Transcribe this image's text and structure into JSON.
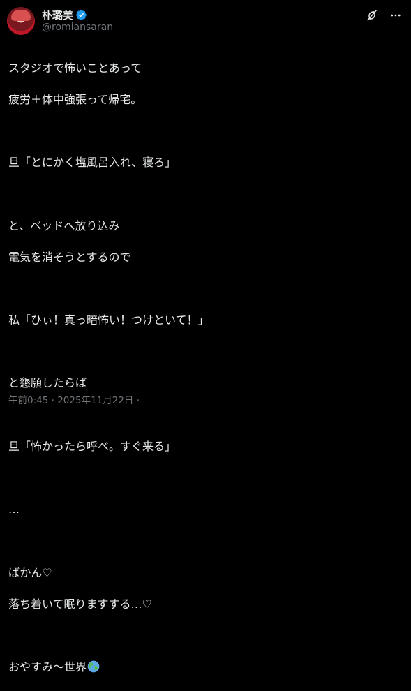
{
  "author": {
    "display_name": "朴璐美",
    "handle": "@romiansaran",
    "verified": true
  },
  "post": {
    "lines": [
      "スタジオで怖いことあって",
      "疲労＋体中強張って帰宅。",
      "",
      "旦「とにかく塩風呂入れ、寝ろ」",
      "",
      "と、ベッドへ放り込み",
      "電気を消そうとするので",
      "",
      "私「ひぃ！真っ暗怖い！つけといて！」",
      "",
      "と懇願したらば",
      "",
      "旦「怖かったら呼べ。すぐ来る」",
      "",
      "…",
      "",
      "ばかん♡",
      "落ち着いて眠りますする…♡",
      "",
      "おやすみ～世界"
    ]
  },
  "meta": {
    "time": "午前0:45",
    "separator": " · ",
    "date": "2025年11月22日",
    "trailing": " ·"
  },
  "icons": {
    "verified": "verified-badge-icon",
    "grok": "grok-icon",
    "more": "more-options-icon",
    "globe": "globe-emoji-icon"
  },
  "colors": {
    "background": "#000000",
    "text": "#e7e9ea",
    "secondary": "#71767b",
    "verified": "#1d9bf0"
  }
}
